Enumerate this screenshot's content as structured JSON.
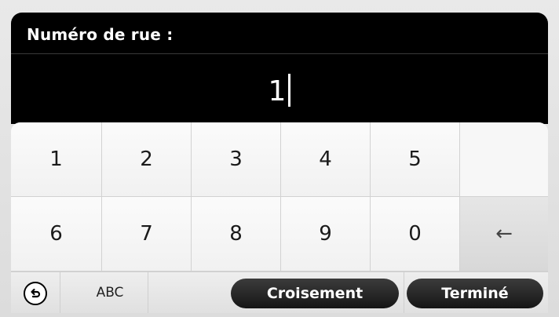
{
  "header": {
    "prompt": "Numéro de rue :",
    "entry_value": "1"
  },
  "keypad": {
    "rows": [
      [
        "1",
        "2",
        "3",
        "4",
        "5",
        ""
      ],
      [
        "6",
        "7",
        "8",
        "9",
        "0",
        "←"
      ]
    ]
  },
  "bottombar": {
    "back_icon": "back-arrow-circle-icon",
    "abc_label": "ABC",
    "crossing_label": "Croisement",
    "done_label": "Terminé"
  },
  "colors": {
    "header_bg": "#000000",
    "key_bg": "#f7f7f7",
    "pill_bg": "#1e1e1e",
    "text_light": "#ffffff"
  }
}
